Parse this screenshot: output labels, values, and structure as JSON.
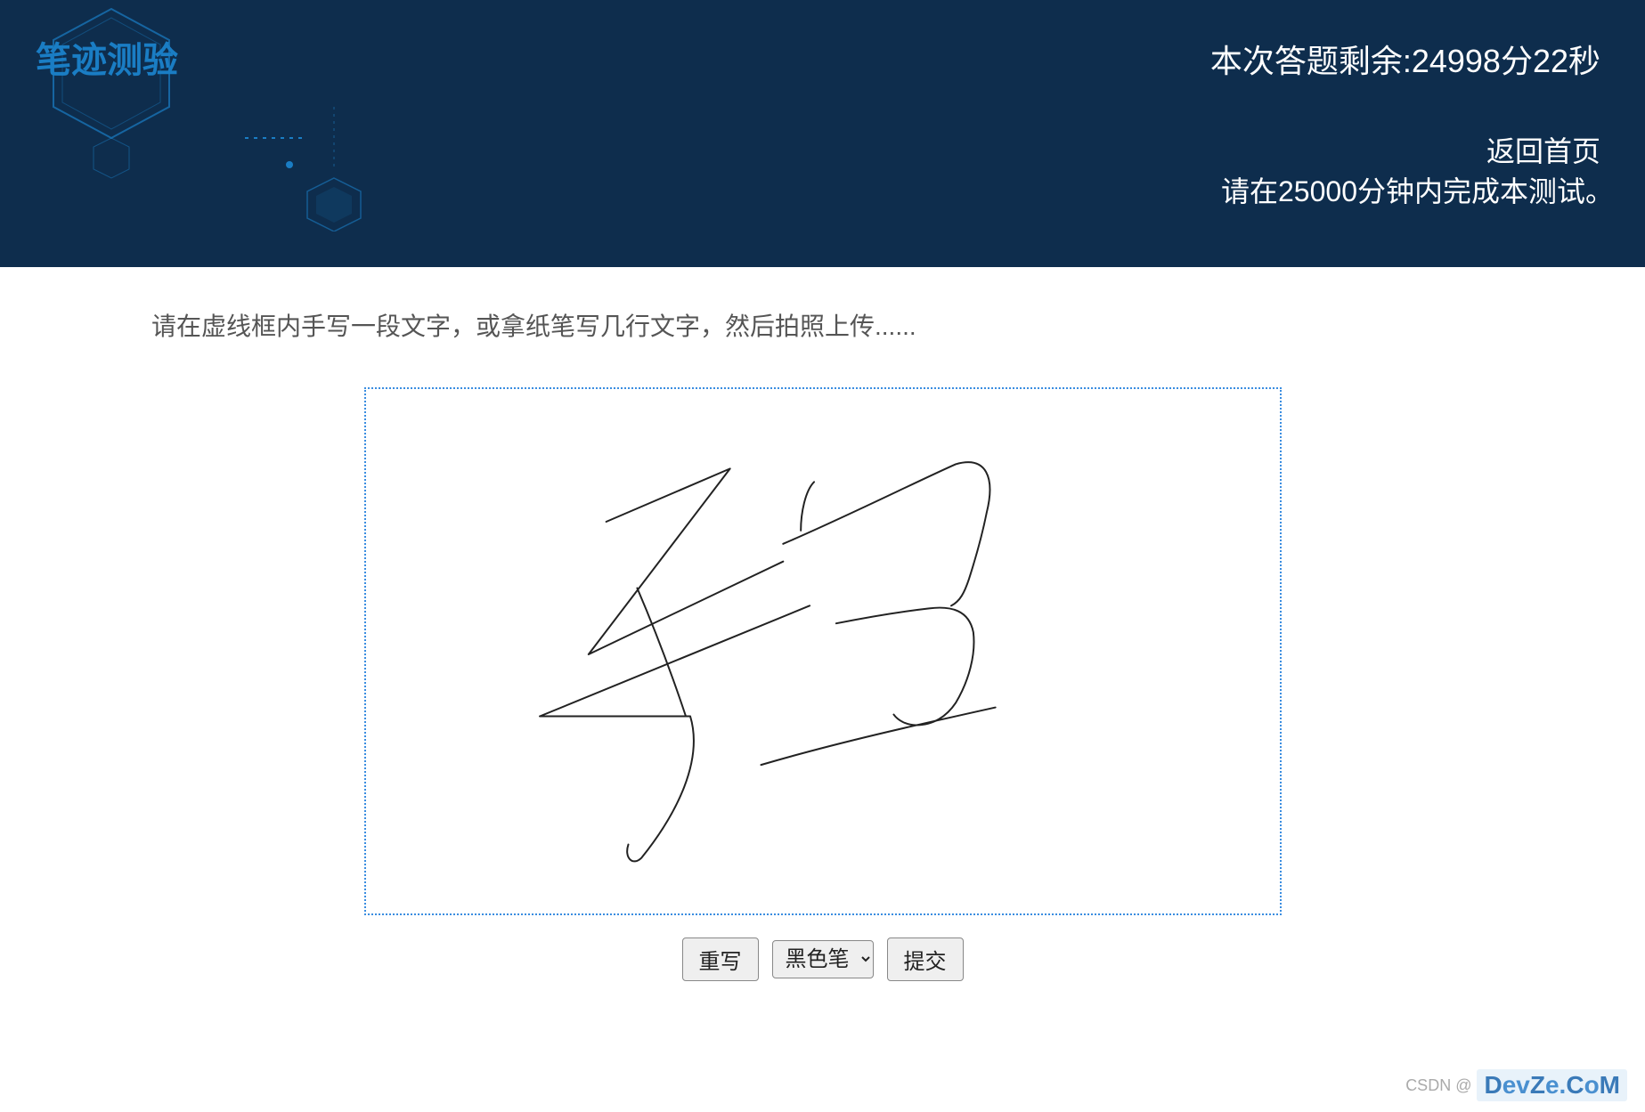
{
  "header": {
    "title": "笔迹测验",
    "timer": "本次答题剩余:24998分22秒",
    "return_link": "返回首页",
    "deadline": "请在25000分钟内完成本测试。"
  },
  "content": {
    "instruction": "请在虚线框内手写一段文字，或拿纸笔写几行文字，然后拍照上传......"
  },
  "controls": {
    "rewrite_label": "重写",
    "pen_selected": "黑色笔",
    "submit_label": "提交"
  },
  "watermark": {
    "csdn": "CSDN @",
    "devze": "DevZe.CoM"
  },
  "colors": {
    "header_bg": "#0e2d4d",
    "title_color": "#1a7dc4",
    "canvas_border": "#3a8de0"
  }
}
